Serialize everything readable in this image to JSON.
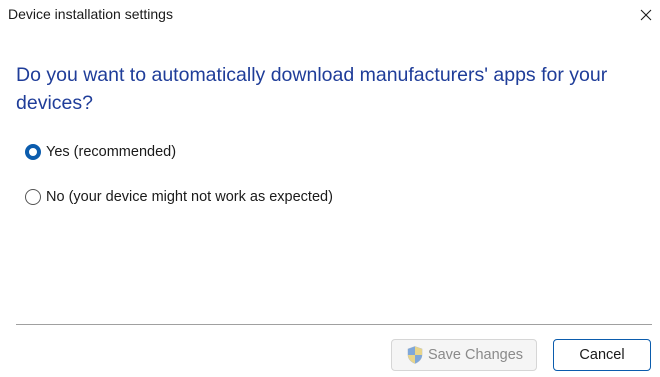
{
  "window": {
    "title": "Device installation settings",
    "close_icon": "close-icon"
  },
  "main": {
    "question": "Do you want to automatically download manufacturers' apps for your devices?",
    "options": [
      {
        "label": "Yes (recommended)",
        "selected": true
      },
      {
        "label": "No (your device might not work as expected)",
        "selected": false
      }
    ]
  },
  "footer": {
    "save_label": "Save Changes",
    "save_enabled": false,
    "save_icon": "uac-shield-icon",
    "cancel_label": "Cancel"
  },
  "colors": {
    "heading": "#1f3d99",
    "accent": "#0b5cad",
    "disabled_text": "#8a8a8a"
  }
}
